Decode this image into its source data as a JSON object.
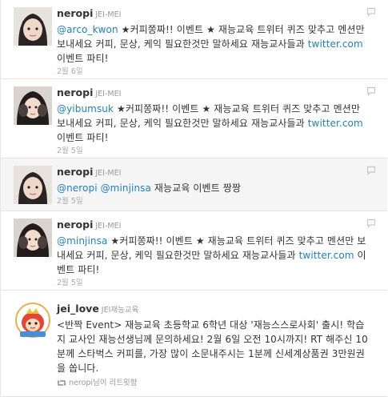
{
  "tweets": [
    {
      "screen_name": "neropi",
      "full_name": "JEI-MEI",
      "segments": [
        {
          "t": "@arco_kwon",
          "link": true
        },
        {
          "t": " ★커피쫑짜!! 이벤트 ★ 재능교육 트위터 퀴즈 맞추고 멘션만 보내세요 커피, 문상, 케익 필요한것만 말하세요 재능교사들과 ",
          "link": false
        },
        {
          "t": "twitter.com",
          "link": true
        },
        {
          "t": " 이벤트 파티!",
          "link": false
        }
      ],
      "time": "2월 6일"
    },
    {
      "screen_name": "neropi",
      "full_name": "JEI-MEI",
      "segments": [
        {
          "t": "@yibumsuk",
          "link": true
        },
        {
          "t": " ★커피쫑짜!! 이벤트 ★ 재능교육 트위터 퀴즈 맞추고 멘션만 보내세요 커피, 문상, 케익 필요한것만 말하세요 재능교사들과 ",
          "link": false
        },
        {
          "t": "twitter.com",
          "link": true
        },
        {
          "t": " 이벤트 파티!",
          "link": false
        }
      ],
      "time": "2월 5일"
    },
    {
      "screen_name": "neropi",
      "full_name": "JEI-MEI",
      "segments": [
        {
          "t": "@neropi",
          "link": true
        },
        {
          "t": " ",
          "link": false
        },
        {
          "t": "@minjinsa",
          "link": true
        },
        {
          "t": " 재능교육 이벤트 짱짱",
          "link": false
        }
      ],
      "time": "2월 5일"
    },
    {
      "screen_name": "neropi",
      "full_name": "JEI-MEI",
      "segments": [
        {
          "t": "@minjinsa",
          "link": true
        },
        {
          "t": " ★커피쫑짜!! 이벤트 ★ 재능교육 트위터 퀴즈 맞추고 멘션만 보내세요 커피, 문상, 케익 필요한것만 말하세요 재능교사들과 ",
          "link": false
        },
        {
          "t": "twitter.com",
          "link": true
        },
        {
          "t": " 이벤트 파티!",
          "link": false
        }
      ],
      "time": "2월 5일"
    },
    {
      "screen_name": "jei_love",
      "full_name": "JEI재능교육",
      "segments": [
        {
          "t": "<반짝 Event> 재능교육 초등학교 6학년 대상 '재능스스로사회' 출시! 학습지 교사인 재능선생님께 문의하세요! 2월 6일 오전 10시까지! RT 해주신 10분께 스타벅스 커피를, 가장 많이 소문내주시는 1분께 신세계상품권 3만원권을 쏩니다.",
          "link": false
        }
      ],
      "retweeted_by": "neropi",
      "retweet_suffix": "님이 리트윗함"
    }
  ]
}
